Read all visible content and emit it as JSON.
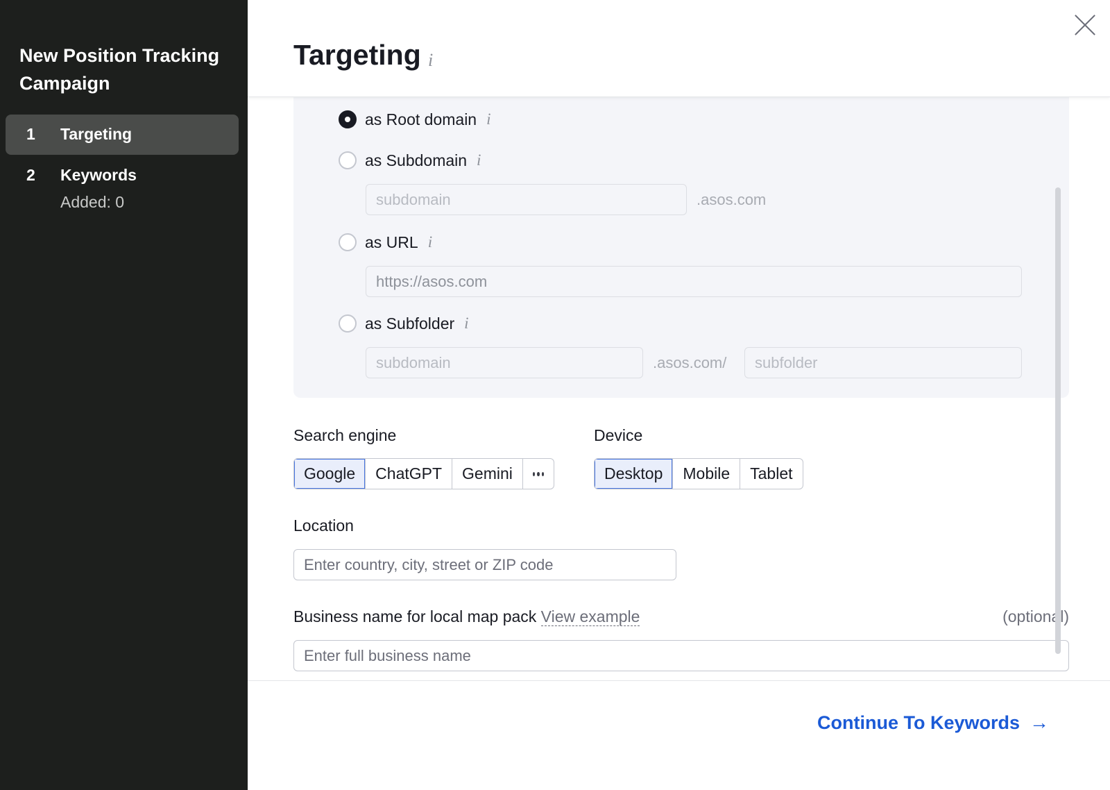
{
  "sidebar": {
    "title": "New Position Tracking Campaign",
    "steps": [
      {
        "num": "1",
        "label": "Targeting",
        "sub": ""
      },
      {
        "num": "2",
        "label": "Keywords",
        "sub": "Added: 0"
      }
    ]
  },
  "header": {
    "title": "Targeting",
    "info": "i"
  },
  "domain_options": {
    "root": {
      "label": "as Root domain",
      "info": "i"
    },
    "subdomain": {
      "label": "as Subdomain",
      "info": "i",
      "placeholder": "subdomain",
      "suffix": ".asos.com"
    },
    "url": {
      "label": "as URL",
      "info": "i",
      "placeholder": "https://asos.com"
    },
    "subfolder": {
      "label": "as Subfolder",
      "info": "i",
      "sub_placeholder": "subdomain",
      "middle": ".asos.com/",
      "folder_placeholder": "subfolder"
    }
  },
  "search_engine": {
    "label": "Search engine",
    "options": [
      "Google",
      "ChatGPT",
      "Gemini"
    ],
    "selected": "Google"
  },
  "device": {
    "label": "Device",
    "options": [
      "Desktop",
      "Mobile",
      "Tablet"
    ],
    "selected": "Desktop"
  },
  "location": {
    "label": "Location",
    "placeholder": "Enter country, city, street or ZIP code"
  },
  "business": {
    "label": "Business name for local map pack",
    "link": "View example",
    "optional": "(optional)",
    "placeholder": "Enter full business name"
  },
  "footer": {
    "continue_label": "Continue To Keywords",
    "arrow": "→"
  }
}
